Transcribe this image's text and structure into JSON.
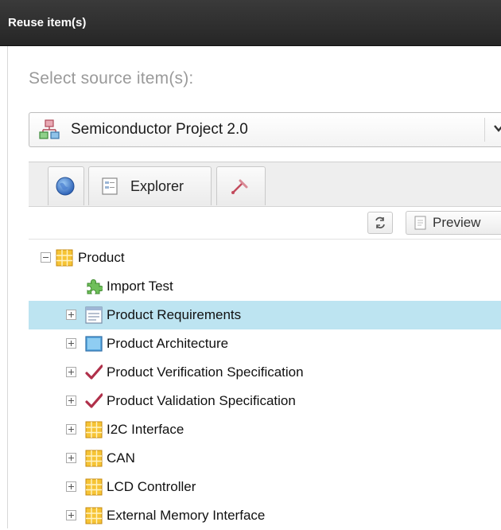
{
  "window": {
    "title": "Reuse item(s)"
  },
  "dialog": {
    "subtitle": "Select source item(s):"
  },
  "project_select": {
    "value": "Semiconductor Project 2.0"
  },
  "tabs": [
    {
      "icon": "globe-icon",
      "label": ""
    },
    {
      "icon": "explorer-icon",
      "label": "Explorer"
    },
    {
      "icon": "pin-icon",
      "label": ""
    }
  ],
  "toolbar": {
    "preview_label": "Preview"
  },
  "tree": {
    "root": {
      "label": "Product",
      "icon": "component-grid-icon",
      "expanded": true
    },
    "items": [
      {
        "label": "Import Test",
        "icon": "puzzle-icon",
        "has_children": false,
        "selected": false
      },
      {
        "label": "Product Requirements",
        "icon": "requirements-doc-icon",
        "has_children": true,
        "selected": true
      },
      {
        "label": "Product Architecture",
        "icon": "architecture-image-icon",
        "has_children": true,
        "selected": false
      },
      {
        "label": "Product Verification Specification",
        "icon": "checkmark-icon",
        "has_children": true,
        "selected": false
      },
      {
        "label": "Product Validation Specification",
        "icon": "checkmark-icon",
        "has_children": true,
        "selected": false
      },
      {
        "label": "I2C Interface",
        "icon": "component-grid-icon",
        "has_children": true,
        "selected": false
      },
      {
        "label": "CAN",
        "icon": "component-grid-icon",
        "has_children": true,
        "selected": false
      },
      {
        "label": "LCD Controller",
        "icon": "component-grid-icon",
        "has_children": true,
        "selected": false
      },
      {
        "label": "External Memory Interface",
        "icon": "component-grid-icon",
        "has_children": true,
        "selected": false
      }
    ]
  },
  "colors": {
    "titlebar": "#2e2e2e",
    "selection": "#bde4f1",
    "component_icon": "#f2b928",
    "check_icon": "#b0304a"
  }
}
